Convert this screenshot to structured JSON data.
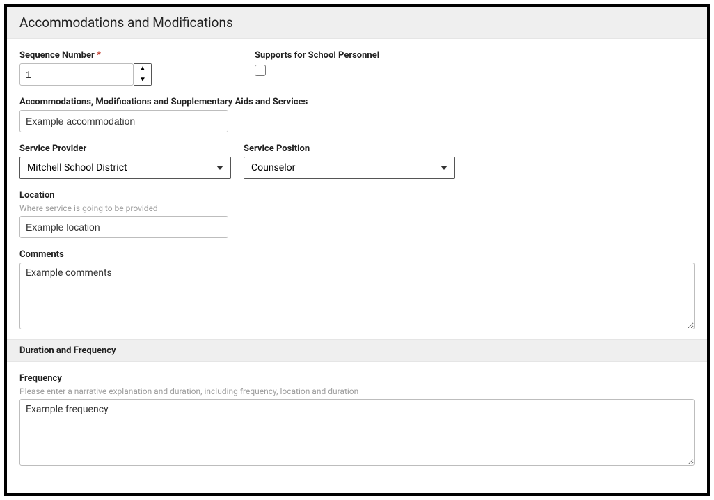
{
  "header": {
    "title": "Accommodations and Modifications"
  },
  "sequence": {
    "label": "Sequence Number",
    "required": "*",
    "value": "1"
  },
  "supports": {
    "label": "Supports for School Personnel",
    "checked": false
  },
  "aids": {
    "label": "Accommodations, Modifications and Supplementary Aids and Services",
    "value": "Example accommodation"
  },
  "provider": {
    "label": "Service Provider",
    "value": "Mitchell School District"
  },
  "position": {
    "label": "Service Position",
    "value": "Counselor"
  },
  "location": {
    "label": "Location",
    "helper": "Where service is going to be provided",
    "value": "Example location"
  },
  "comments": {
    "label": "Comments",
    "value": "Example comments"
  },
  "duration": {
    "title": "Duration and Frequency"
  },
  "frequency": {
    "label": "Frequency",
    "helper": "Please enter a narrative explanation and duration, including frequency, location and duration",
    "value": "Example frequency"
  }
}
